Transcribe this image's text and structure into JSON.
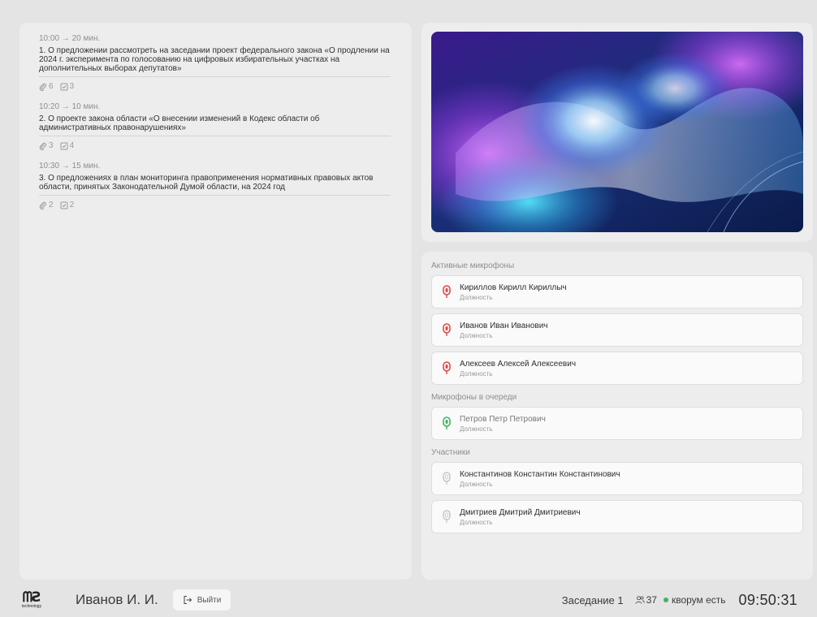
{
  "agenda": [
    {
      "time": "10:00 → 20 мин.",
      "title": "1. О предложении рассмотреть на заседании проект федерального закона «О продлении на 2024 г. эксперимента по голосованию на цифровых избирательных участках на дополнительных выборах депутатов»",
      "attachments": "6",
      "tasks": "3"
    },
    {
      "time": "10:20 → 10 мин.",
      "title": "2. О проекте закона области «О внесении изменений в Кодекс области об административных правонарушениях»",
      "attachments": "3",
      "tasks": "4"
    },
    {
      "time": "10:30 → 15 мин.",
      "title": "3. О предложениях в план мониторинга правоприменения нормативных правовых актов области, принятых Законодательной Думой области, на 2024 год",
      "attachments": "2",
      "tasks": "2"
    }
  ],
  "microphones": {
    "active_label": "Активные микрофоны",
    "active": [
      {
        "name": "Кириллов Кирилл Кириллыч",
        "role": "Должность"
      },
      {
        "name": "Иванов Иван Иванович",
        "role": "Должность"
      },
      {
        "name": "Алексеев Алексей Алексеевич",
        "role": "Должность"
      }
    ],
    "queue_label": "Микрофоны в очереди",
    "queue": [
      {
        "name": "Петров Петр Петрович",
        "role": "Должность"
      }
    ],
    "participants_label": "Участники",
    "participants": [
      {
        "name": "Константинов Константин Константинович",
        "role": "Должность"
      },
      {
        "name": "Дмитриев Дмитрий Дмитриевич",
        "role": "Должность"
      }
    ]
  },
  "footer": {
    "logo_mark": "ᗰƧ",
    "logo_sub": "technology",
    "user_name": "Иванов И. И.",
    "logout_label": "Выйти",
    "session_name": "Заседание 1",
    "participants_count": "37",
    "quorum_text": "кворум есть",
    "clock": "09:50:31"
  },
  "colors": {
    "mic_active": "#e04848",
    "mic_queue": "#3cb55d",
    "mic_idle": "#c4c4c4",
    "quorum_dot": "#3cb55d"
  },
  "icons": {
    "attachment": "paperclip-icon",
    "task": "checkbox-icon",
    "microphone": "microphone-icon",
    "logout": "logout-icon",
    "participants": "people-icon"
  }
}
